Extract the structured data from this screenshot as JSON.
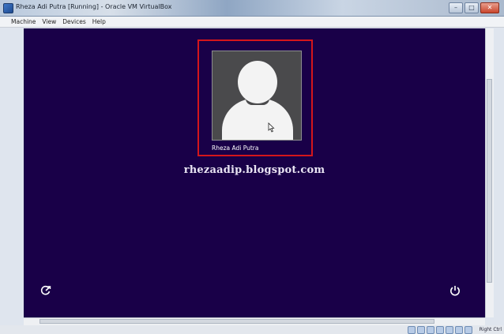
{
  "window": {
    "title": "Rheza Adi Putra [Running] - Oracle VM VirtualBox",
    "buttons": {
      "minimize": "–",
      "maximize": "□",
      "close": "✕"
    }
  },
  "menu": [
    "Machine",
    "View",
    "Devices",
    "Help"
  ],
  "vm": {
    "background": "#190048",
    "selection_color": "#d4161b",
    "user": {
      "name": "Rheza Adi Putra",
      "avatar_icon": "user-silhouette-icon"
    },
    "watermark": "rhezaadip.blogspot.com",
    "ease_of_access_icon": "ease-of-access-icon",
    "power_icon": "power-icon"
  },
  "statusbar": {
    "icons": [
      "hard-disk-icon",
      "optical-drive-icon",
      "usb-icon",
      "shared-folder-icon",
      "network-icon",
      "display-icon",
      "mouse-integration-icon"
    ],
    "host_key": "Right Ctrl"
  }
}
